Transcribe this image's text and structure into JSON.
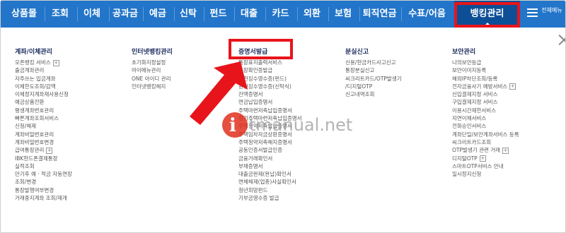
{
  "nav": {
    "items": [
      "상품몰",
      "조회",
      "이체",
      "공과금",
      "예금",
      "신탁",
      "펀드",
      "대출",
      "카드",
      "외환",
      "보험",
      "퇴직연금",
      "수표/어음",
      "뱅킹관리"
    ],
    "active": "뱅킹관리",
    "menu_label": "전체메뉴",
    "colors": {
      "bar": "#2275c9",
      "active": "#0c4f96",
      "highlight": "#e8141b"
    }
  },
  "columns": [
    {
      "title": "계좌/이체관리",
      "items": [
        "오픈뱅킹 서비스",
        "출금계좌관리",
        "자주쓰는 입금계좌",
        "이체한도조회/감액",
        "이체정지계좌재사용신청",
        "예금상품전환",
        "평생계좌번호관리",
        "빠른계좌조회서비스",
        "신청/해제",
        "계좌비밀번호관리",
        "계좌비밀번호변경",
        "급여통장관리",
        "IBK현드폰결제통장",
        "실적조회",
        "만기후 예 · 적금 자동연장",
        "조회/변경",
        "통장발행여부변경",
        "거래중지계좌 조회/재개"
      ],
      "plus_items": [
        "오픈뱅킹 서비스",
        "급여통장관리"
      ]
    },
    {
      "title": "인터넷뱅킹관리",
      "items": [
        "초기화지정설정",
        "마이메뉴관리",
        "ONE 아이디 관리",
        "인터넷뱅킹해지"
      ]
    },
    {
      "title": "증명서발급",
      "items": [
        "통장표지출력서비스",
        "통장확인증발급",
        "원천징수영수증(펀드)",
        "원천징수영수증(신탁식)",
        "잔액증명서",
        "연금납입증명서",
        "주택마련저축납입증명서",
        "장기주택마련저축납입증명서",
        "주택청약저축납입증명서",
        "주택임차자금상환증명서",
        "주택청약저축해지증명서",
        "공동인증서발급인증",
        "금융거래확인서",
        "부채증명서",
        "대출금완제(완납)확인서",
        "연체해제(업종)사실확인서",
        "청년희망펀드",
        "기부금영수증 발급"
      ]
    },
    {
      "title": "분실신고",
      "items": [
        "신용/현금카드사고신고",
        "통장분실신고",
        "씨크리트카드/OTP발생기",
        "/디지털OTP",
        "신고내역조회"
      ]
    },
    {
      "title": "보안관리",
      "items": [
        "나의보안등급",
        "보안이미지등록",
        "해외IP차단조회/등록",
        "전자금융사기 예방서비스",
        "신입결제지정 서비스",
        "구입결제지정 서비스",
        "이용시간제한서비스",
        "지연이체서비스",
        "전화승인서비스",
        "계좌단일/보안계좌서비스 등록",
        "씨크리트카드조회",
        "OTP발생기 관련 거래",
        "디지털OTP",
        "스마트OTP서비스 안내",
        "일시정지신청"
      ],
      "plus_items": [
        "전자금융사기 예방서비스",
        "OTP발생기 관련 거래",
        "디지털OTP"
      ]
    }
  ],
  "watermark": {
    "badge": "i",
    "text": "tmanual.net"
  }
}
